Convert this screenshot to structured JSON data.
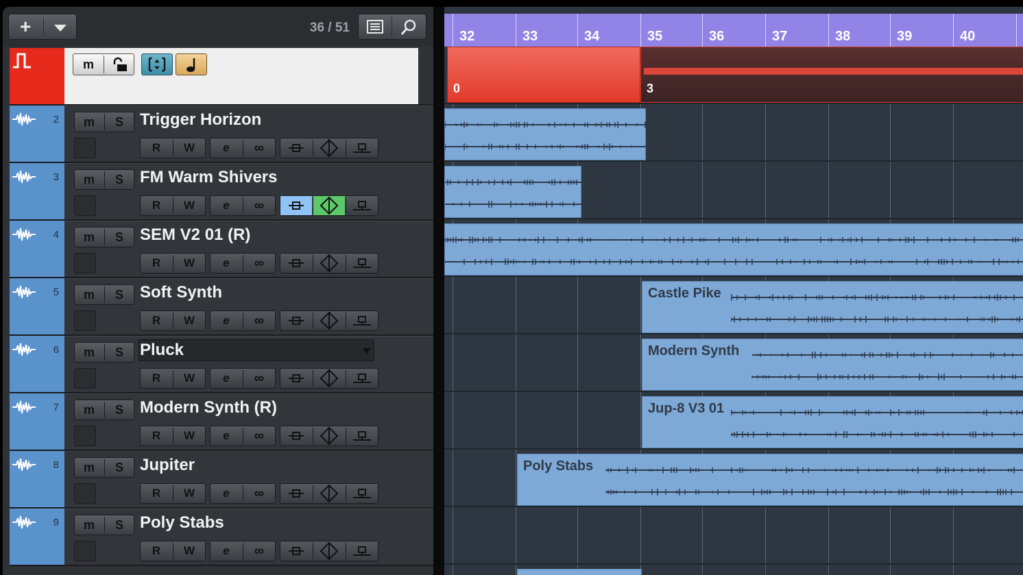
{
  "toolbar": {
    "add_label": "+",
    "track_count": "36 / 51"
  },
  "chord_track": {
    "buttons": [
      "m",
      "lock",
      "adjust",
      "note"
    ]
  },
  "tracks": [
    {
      "number": "2",
      "name": "Trigger Horizon"
    },
    {
      "number": "3",
      "name": "FM Warm Shivers"
    },
    {
      "number": "4",
      "name": "SEM V2 01 (R)"
    },
    {
      "number": "5",
      "name": "Soft Synth"
    },
    {
      "number": "6",
      "name": "Pluck"
    },
    {
      "number": "7",
      "name": "Modern Synth (R)"
    },
    {
      "number": "8",
      "name": "Jupiter"
    },
    {
      "number": "9",
      "name": "Poly Stabs"
    }
  ],
  "track_buttons": {
    "mute": "m",
    "solo": "S",
    "read": "R",
    "write": "W",
    "edit": "e",
    "link": "∞"
  },
  "ruler": {
    "bars": [
      "32",
      "33",
      "34",
      "35",
      "36",
      "37",
      "38",
      "39",
      "40"
    ]
  },
  "chord_events": [
    "0",
    "3"
  ],
  "parts": [
    {
      "label": "Castle Pike"
    },
    {
      "label": "Modern Synth"
    },
    {
      "label": "Jup-8 V3 01"
    },
    {
      "label": "Poly Stabs"
    }
  ],
  "colors": {
    "track_strip": "#5a92cc",
    "chord_track": "#e5291a",
    "ruler": "#9284e6",
    "part": "#7ea8d6",
    "read_active": "#8fc2f5",
    "write_active": "#5cc86a"
  },
  "icons": [
    "plus-icon",
    "dropdown-icon",
    "list-icon",
    "search-icon",
    "waveform-icon",
    "chord-icon",
    "lock-icon",
    "note-icon"
  ]
}
